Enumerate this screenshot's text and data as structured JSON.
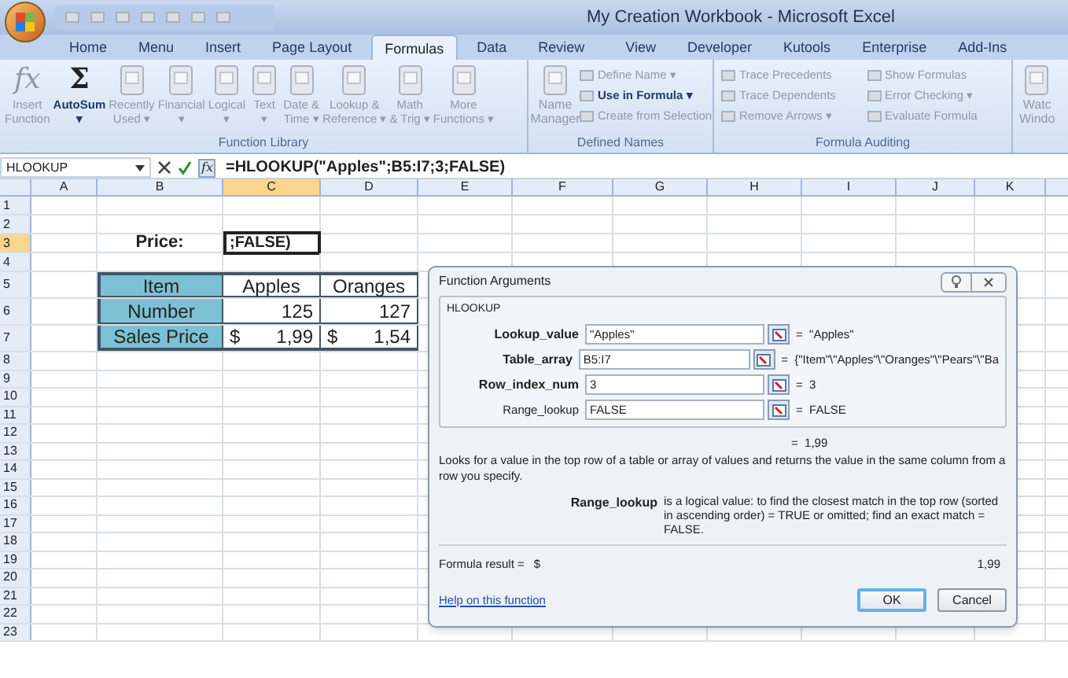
{
  "window": {
    "title": "My Creation Workbook - Microsoft Excel"
  },
  "tabs": [
    {
      "label": "Home",
      "selected": false
    },
    {
      "label": "Menu",
      "selected": false
    },
    {
      "label": "Insert",
      "selected": false
    },
    {
      "label": "Page Layout",
      "selected": false
    },
    {
      "label": "Formulas",
      "selected": true
    },
    {
      "label": "Data",
      "selected": false
    },
    {
      "label": "Review",
      "selected": false
    },
    {
      "label": "View",
      "selected": false
    },
    {
      "label": "Developer",
      "selected": false
    },
    {
      "label": "Kutools",
      "selected": false
    },
    {
      "label": "Enterprise",
      "selected": false
    },
    {
      "label": "Add-Ins",
      "selected": false
    }
  ],
  "ribbon": {
    "function_library": {
      "label": "Function Library",
      "items": [
        {
          "kind": "glyph",
          "glyph": "fx",
          "lines": [
            "Insert",
            "Function"
          ],
          "disabled": true
        },
        {
          "kind": "glyph",
          "glyph": "Σ",
          "lines": [
            "AutoSum",
            "▾"
          ],
          "disabled": false
        },
        {
          "kind": "book",
          "lines": [
            "Recently",
            "Used ▾"
          ],
          "disabled": true
        },
        {
          "kind": "book",
          "lines": [
            "Financial",
            "▾"
          ],
          "disabled": true
        },
        {
          "kind": "book",
          "lines": [
            "Logical",
            "▾"
          ],
          "disabled": true
        },
        {
          "kind": "book",
          "lines": [
            "Text",
            "▾"
          ],
          "disabled": true
        },
        {
          "kind": "book",
          "lines": [
            "Date &",
            "Time ▾"
          ],
          "disabled": true
        },
        {
          "kind": "book",
          "lines": [
            "Lookup &",
            "Reference ▾"
          ],
          "disabled": true
        },
        {
          "kind": "book",
          "lines": [
            "Math",
            "& Trig ▾"
          ],
          "disabled": true
        },
        {
          "kind": "book",
          "lines": [
            "More",
            "Functions ▾"
          ],
          "disabled": true
        }
      ]
    },
    "defined_names": {
      "label": "Defined Names",
      "manager": [
        "Name",
        "Manager"
      ],
      "items": [
        {
          "label": "Define Name ▾",
          "disabled": true
        },
        {
          "label": "Use in Formula ▾",
          "disabled": false
        },
        {
          "label": "Create from Selection",
          "disabled": true
        }
      ]
    },
    "formula_auditing": {
      "label": "Formula Auditing",
      "items": [
        {
          "label": "Trace Precedents",
          "disabled": true
        },
        {
          "label": "Show Formulas",
          "disabled": true
        },
        {
          "label": "Trace Dependents",
          "disabled": true
        },
        {
          "label": "Error Checking ▾",
          "disabled": true
        },
        {
          "label": "Remove Arrows ▾",
          "disabled": true
        },
        {
          "label": "Evaluate Formula",
          "disabled": true
        }
      ]
    },
    "watch": [
      "Watc",
      "Windo"
    ]
  },
  "formula_bar": {
    "name_box": "HLOOKUP",
    "fx": "fx",
    "formula": "=HLOOKUP(\"Apples\";B5:I7;3;FALSE)"
  },
  "sheet": {
    "columns": [
      {
        "label": "A",
        "selected": false
      },
      {
        "label": "B",
        "selected": false
      },
      {
        "label": "C",
        "selected": true
      },
      {
        "label": "D",
        "selected": false
      },
      {
        "label": "E",
        "selected": false
      },
      {
        "label": "F",
        "selected": false
      },
      {
        "label": "G",
        "selected": false
      },
      {
        "label": "H",
        "selected": false
      },
      {
        "label": "I",
        "selected": false
      },
      {
        "label": "J",
        "selected": false
      },
      {
        "label": "K",
        "selected": false
      }
    ],
    "rows": [
      {
        "label": "1",
        "selected": false
      },
      {
        "label": "2",
        "selected": false
      },
      {
        "label": "3",
        "selected": true
      },
      {
        "label": "4",
        "selected": false
      },
      {
        "label": "5",
        "selected": false
      },
      {
        "label": "6",
        "selected": false
      },
      {
        "label": "7",
        "selected": false
      },
      {
        "label": "8",
        "selected": false
      },
      {
        "label": "9",
        "selected": false
      },
      {
        "label": "10",
        "selected": false
      },
      {
        "label": "11",
        "selected": false
      },
      {
        "label": "12",
        "selected": false
      },
      {
        "label": "13",
        "selected": false
      },
      {
        "label": "14",
        "selected": false
      },
      {
        "label": "15",
        "selected": false
      },
      {
        "label": "16",
        "selected": false
      },
      {
        "label": "17",
        "selected": false
      },
      {
        "label": "18",
        "selected": false
      },
      {
        "label": "19",
        "selected": false
      },
      {
        "label": "20",
        "selected": false
      },
      {
        "label": "21",
        "selected": false
      },
      {
        "label": "22",
        "selected": false
      },
      {
        "label": "23",
        "selected": false
      }
    ],
    "price": {
      "label": "Price:",
      "value": ";FALSE)"
    },
    "table": [
      {
        "header": "Item",
        "cells": [
          {
            "text": "Apples"
          },
          {
            "text": "Oranges"
          }
        ]
      },
      {
        "header": "Number",
        "cells": [
          {
            "text": "125"
          },
          {
            "text": "127"
          }
        ]
      },
      {
        "header": "Sales Price",
        "cells": [
          {
            "currency": "$",
            "text": "1,99"
          },
          {
            "currency": "$",
            "text": "1,54"
          }
        ]
      }
    ]
  },
  "dialog": {
    "title": "Function Arguments",
    "function": "HLOOKUP",
    "args": [
      {
        "name": "Lookup_value",
        "required": true,
        "value": "\"Apples\"",
        "result": "=  \"Apples\""
      },
      {
        "name": "Table_array",
        "required": true,
        "value": "B5:I7",
        "result": "=  {\"Item\"\\\"Apples\"\\\"Oranges\"\\\"Pears\"\\\"Ba"
      },
      {
        "name": "Row_index_num",
        "required": true,
        "value": "3",
        "result": "=  3"
      },
      {
        "name": "Range_lookup",
        "required": false,
        "value": "FALSE",
        "result": "=  FALSE"
      }
    ],
    "result": "=  1,99",
    "description": "Looks for a value in the top row of a table or array of values and returns the value in the same column from a row you specify.",
    "arg_help": {
      "name": "Range_lookup",
      "text": "is a logical value: to find the closest match in the top row (sorted in ascending order) = TRUE or omitted; find an exact match = FALSE."
    },
    "formula_result": {
      "label": "Formula result =",
      "currency": "$",
      "value": "1,99"
    },
    "help_link": "Help on this function",
    "buttons": [
      {
        "label": "OK",
        "default": true
      },
      {
        "label": "Cancel",
        "default": false
      }
    ]
  }
}
